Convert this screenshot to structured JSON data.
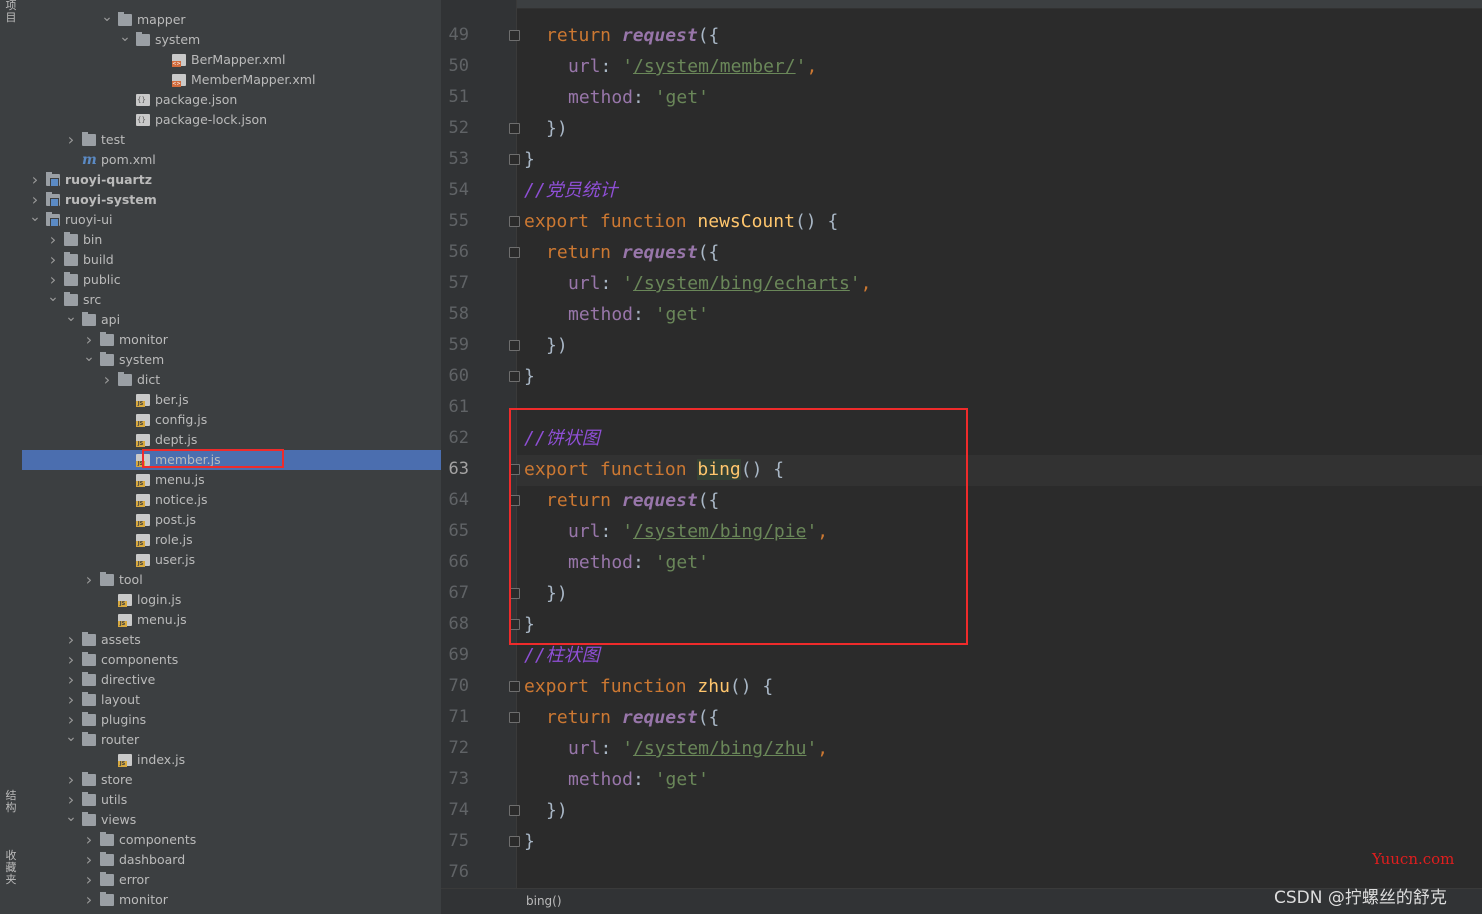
{
  "side_tabs": {
    "top": "项目",
    "middle": "结构",
    "bottom": "收藏夹"
  },
  "tree": [
    {
      "label": "mapper",
      "type": "folder",
      "depth": 5,
      "expanded": true
    },
    {
      "label": "system",
      "type": "folder",
      "depth": 6,
      "expanded": true
    },
    {
      "label": "BerMapper.xml",
      "type": "xml",
      "depth": 8
    },
    {
      "label": "MemberMapper.xml",
      "type": "xml",
      "depth": 8
    },
    {
      "label": "package.json",
      "type": "json",
      "depth": 6
    },
    {
      "label": "package-lock.json",
      "type": "json",
      "depth": 6
    },
    {
      "label": "test",
      "type": "folder",
      "depth": 3,
      "expanded": false
    },
    {
      "label": "pom.xml",
      "type": "maven",
      "depth": 3
    },
    {
      "label": "ruoyi-quartz",
      "type": "module",
      "depth": 1,
      "expanded": false,
      "bold": true
    },
    {
      "label": "ruoyi-system",
      "type": "module",
      "depth": 1,
      "expanded": false,
      "bold": true
    },
    {
      "label": "ruoyi-ui",
      "type": "module",
      "depth": 1,
      "expanded": true
    },
    {
      "label": "bin",
      "type": "folder",
      "depth": 2,
      "expanded": false
    },
    {
      "label": "build",
      "type": "folder",
      "depth": 2,
      "expanded": false
    },
    {
      "label": "public",
      "type": "folder",
      "depth": 2,
      "expanded": false
    },
    {
      "label": "src",
      "type": "folder",
      "depth": 2,
      "expanded": true
    },
    {
      "label": "api",
      "type": "folder",
      "depth": 3,
      "expanded": true
    },
    {
      "label": "monitor",
      "type": "folder",
      "depth": 4,
      "expanded": false
    },
    {
      "label": "system",
      "type": "folder",
      "depth": 4,
      "expanded": true
    },
    {
      "label": "dict",
      "type": "folder",
      "depth": 5,
      "expanded": false
    },
    {
      "label": "ber.js",
      "type": "js",
      "depth": 6
    },
    {
      "label": "config.js",
      "type": "js",
      "depth": 6
    },
    {
      "label": "dept.js",
      "type": "js",
      "depth": 6
    },
    {
      "label": "member.js",
      "type": "js",
      "depth": 6,
      "selected": true
    },
    {
      "label": "menu.js",
      "type": "js",
      "depth": 6
    },
    {
      "label": "notice.js",
      "type": "js",
      "depth": 6
    },
    {
      "label": "post.js",
      "type": "js",
      "depth": 6
    },
    {
      "label": "role.js",
      "type": "js",
      "depth": 6
    },
    {
      "label": "user.js",
      "type": "js",
      "depth": 6
    },
    {
      "label": "tool",
      "type": "folder",
      "depth": 4,
      "expanded": false
    },
    {
      "label": "login.js",
      "type": "js",
      "depth": 5
    },
    {
      "label": "menu.js",
      "type": "js",
      "depth": 5
    },
    {
      "label": "assets",
      "type": "folder",
      "depth": 3,
      "expanded": false
    },
    {
      "label": "components",
      "type": "folder",
      "depth": 3,
      "expanded": false
    },
    {
      "label": "directive",
      "type": "folder",
      "depth": 3,
      "expanded": false
    },
    {
      "label": "layout",
      "type": "folder",
      "depth": 3,
      "expanded": false
    },
    {
      "label": "plugins",
      "type": "folder",
      "depth": 3,
      "expanded": false
    },
    {
      "label": "router",
      "type": "folder",
      "depth": 3,
      "expanded": true
    },
    {
      "label": "index.js",
      "type": "js",
      "depth": 5
    },
    {
      "label": "store",
      "type": "folder",
      "depth": 3,
      "expanded": false
    },
    {
      "label": "utils",
      "type": "folder",
      "depth": 3,
      "expanded": false
    },
    {
      "label": "views",
      "type": "folder",
      "depth": 3,
      "expanded": true
    },
    {
      "label": "components",
      "type": "folder",
      "depth": 4,
      "expanded": false
    },
    {
      "label": "dashboard",
      "type": "folder",
      "depth": 4,
      "expanded": false
    },
    {
      "label": "error",
      "type": "folder",
      "depth": 4,
      "expanded": false
    },
    {
      "label": "monitor",
      "type": "folder",
      "depth": 4,
      "expanded": false
    }
  ],
  "code": [
    {
      "n": "49",
      "fold": true,
      "segs": [
        [
          "sp4",
          ""
        ],
        [
          "kw",
          "return "
        ],
        [
          "it",
          "request"
        ],
        [
          "",
          "({"
        ]
      ]
    },
    {
      "n": "50",
      "fold": false,
      "segs": [
        [
          "sp8",
          ""
        ],
        [
          "pr",
          "url"
        ],
        [
          "",
          ": "
        ],
        [
          "st",
          "'"
        ],
        [
          "su",
          "/system/member/"
        ],
        [
          "st",
          "'"
        ],
        [
          "kw",
          ","
        ]
      ]
    },
    {
      "n": "51",
      "fold": false,
      "segs": [
        [
          "sp8",
          ""
        ],
        [
          "pr",
          "method"
        ],
        [
          "",
          ": "
        ],
        [
          "st",
          "'get'"
        ]
      ]
    },
    {
      "n": "52",
      "fold": true,
      "segs": [
        [
          "sp4",
          ""
        ],
        [
          "",
          "})"
        ]
      ]
    },
    {
      "n": "53",
      "fold": true,
      "segs": [
        [
          "",
          "}"
        ]
      ]
    },
    {
      "n": "54",
      "fold": false,
      "segs": [
        [
          "cm",
          "//党员统计"
        ]
      ]
    },
    {
      "n": "55",
      "fold": true,
      "segs": [
        [
          "kw",
          "export function "
        ],
        [
          "fn",
          "newsCount"
        ],
        [
          "",
          "() {"
        ]
      ]
    },
    {
      "n": "56",
      "fold": true,
      "segs": [
        [
          "sp4",
          ""
        ],
        [
          "kw",
          "return "
        ],
        [
          "it",
          "request"
        ],
        [
          "",
          "({"
        ]
      ]
    },
    {
      "n": "57",
      "fold": false,
      "segs": [
        [
          "sp8",
          ""
        ],
        [
          "pr",
          "url"
        ],
        [
          "",
          ": "
        ],
        [
          "st",
          "'"
        ],
        [
          "su",
          "/system/bing/echarts"
        ],
        [
          "st",
          "'"
        ],
        [
          "kw",
          ","
        ]
      ]
    },
    {
      "n": "58",
      "fold": false,
      "segs": [
        [
          "sp8",
          ""
        ],
        [
          "pr",
          "method"
        ],
        [
          "",
          ": "
        ],
        [
          "st",
          "'get'"
        ]
      ]
    },
    {
      "n": "59",
      "fold": true,
      "segs": [
        [
          "sp4",
          ""
        ],
        [
          "",
          "})"
        ]
      ]
    },
    {
      "n": "60",
      "fold": true,
      "segs": [
        [
          "",
          "}"
        ]
      ]
    },
    {
      "n": "61",
      "fold": false,
      "segs": []
    },
    {
      "n": "62",
      "fold": false,
      "segs": [
        [
          "cm",
          "//饼状图"
        ]
      ]
    },
    {
      "n": "63",
      "fold": true,
      "cur": true,
      "segs": [
        [
          "kw",
          "export function "
        ],
        [
          "fnb",
          "bing"
        ],
        [
          "",
          "() {"
        ]
      ]
    },
    {
      "n": "64",
      "fold": true,
      "segs": [
        [
          "sp4",
          ""
        ],
        [
          "kw",
          "return "
        ],
        [
          "it",
          "request"
        ],
        [
          "",
          "({"
        ]
      ]
    },
    {
      "n": "65",
      "fold": false,
      "segs": [
        [
          "sp8",
          ""
        ],
        [
          "pr",
          "url"
        ],
        [
          "",
          ": "
        ],
        [
          "st",
          "'"
        ],
        [
          "su",
          "/system/bing/pie"
        ],
        [
          "st",
          "'"
        ],
        [
          "kw",
          ","
        ]
      ]
    },
    {
      "n": "66",
      "fold": false,
      "segs": [
        [
          "sp8",
          ""
        ],
        [
          "pr",
          "method"
        ],
        [
          "",
          ": "
        ],
        [
          "st",
          "'get'"
        ]
      ]
    },
    {
      "n": "67",
      "fold": true,
      "segs": [
        [
          "sp4",
          ""
        ],
        [
          "",
          "})"
        ]
      ]
    },
    {
      "n": "68",
      "fold": true,
      "segs": [
        [
          "",
          "}"
        ]
      ]
    },
    {
      "n": "69",
      "fold": false,
      "segs": [
        [
          "cm",
          "//柱状图"
        ]
      ]
    },
    {
      "n": "70",
      "fold": true,
      "segs": [
        [
          "kw",
          "export function "
        ],
        [
          "fn",
          "zhu"
        ],
        [
          "",
          "() {"
        ]
      ]
    },
    {
      "n": "71",
      "fold": true,
      "segs": [
        [
          "sp4",
          ""
        ],
        [
          "kw",
          "return "
        ],
        [
          "it",
          "request"
        ],
        [
          "",
          "({"
        ]
      ]
    },
    {
      "n": "72",
      "fold": false,
      "segs": [
        [
          "sp8",
          ""
        ],
        [
          "pr",
          "url"
        ],
        [
          "",
          ": "
        ],
        [
          "st",
          "'"
        ],
        [
          "su",
          "/system/bing/zhu"
        ],
        [
          "st",
          "'"
        ],
        [
          "kw",
          ","
        ]
      ]
    },
    {
      "n": "73",
      "fold": false,
      "segs": [
        [
          "sp8",
          ""
        ],
        [
          "pr",
          "method"
        ],
        [
          "",
          ": "
        ],
        [
          "st",
          "'get'"
        ]
      ]
    },
    {
      "n": "74",
      "fold": true,
      "segs": [
        [
          "sp4",
          ""
        ],
        [
          "",
          "})"
        ]
      ]
    },
    {
      "n": "75",
      "fold": true,
      "segs": [
        [
          "",
          "}"
        ]
      ]
    },
    {
      "n": "76",
      "fold": false,
      "segs": []
    }
  ],
  "breadcrumb": "bing()",
  "watermark": {
    "site": "Yuucn.com",
    "credit": "CSDN @拧螺丝的舒克"
  }
}
